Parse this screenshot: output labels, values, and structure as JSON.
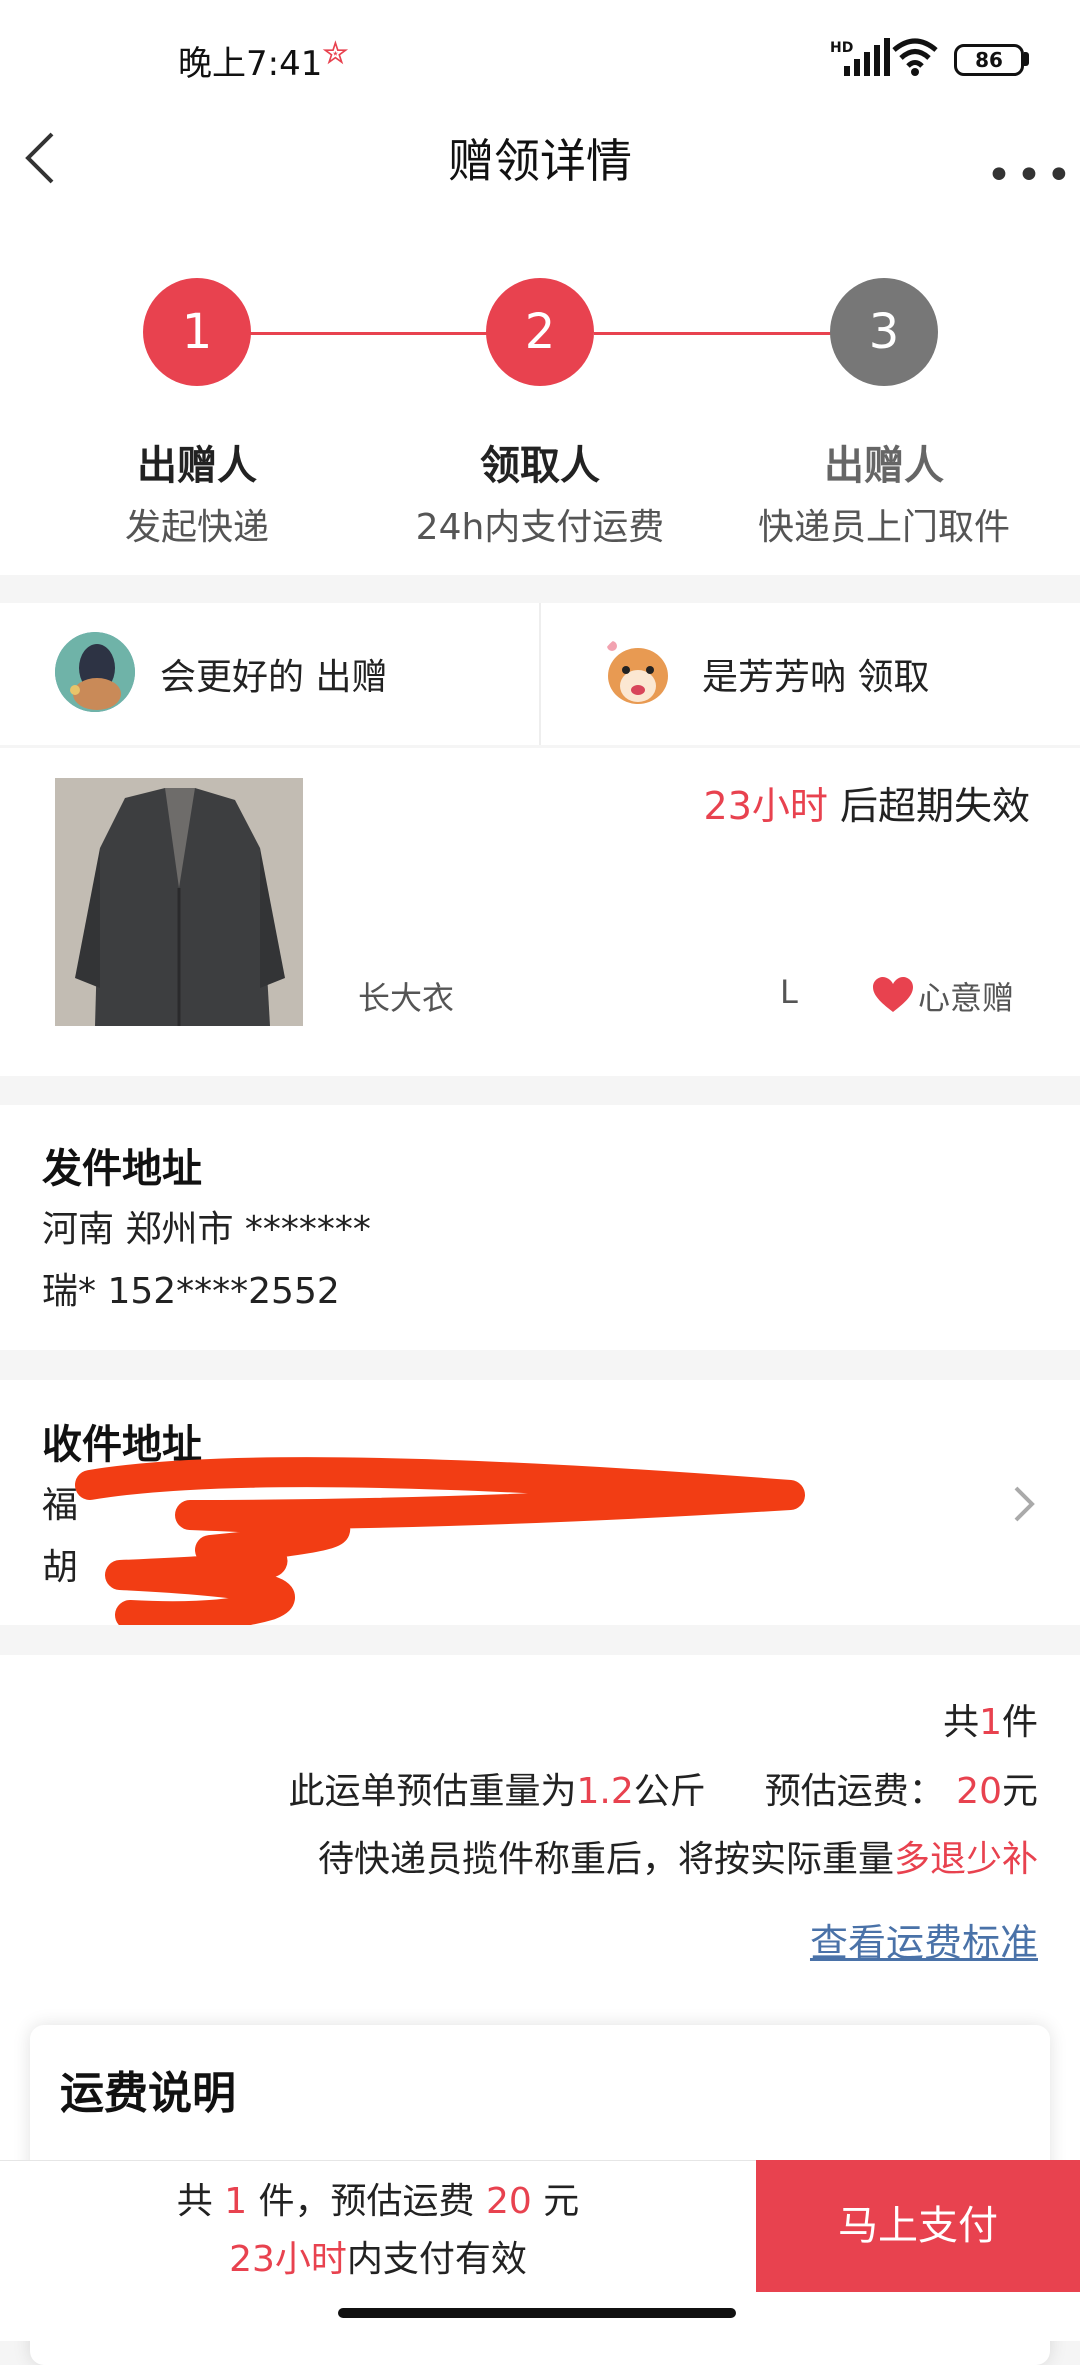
{
  "status_bar": {
    "time": "晚上7:41",
    "network": "HD",
    "battery": "86"
  },
  "header": {
    "title": "赠领详情"
  },
  "steps": [
    {
      "number": "1",
      "title": "出赠人",
      "subtitle": "发起快递"
    },
    {
      "number": "2",
      "title": "领取人",
      "subtitle": "24h内支付运费"
    },
    {
      "number": "3",
      "title": "出赠人",
      "subtitle": "快递员上门取件"
    }
  ],
  "people": {
    "giver": "会更好的 出赠",
    "receiver": "是芳芳吶 领取"
  },
  "item": {
    "expire_time": "23小时",
    "expire_suffix": " 后超期失效",
    "name": "长大衣",
    "size": "L",
    "gift_type": "心意赠"
  },
  "sender_address": {
    "title": "发件地址",
    "line1": "河南 郑州市 *******",
    "line2": "瑞* 152****2552"
  },
  "receiver_address": {
    "title": "收件地址",
    "line1": "福",
    "line2": "胡"
  },
  "fee": {
    "count_prefix": "共",
    "count": "1",
    "count_suffix": "件",
    "weight_prefix": "此运单预估重量为",
    "weight": "1.2",
    "weight_unit": "公斤",
    "fee_prefix": "预估运费：",
    "fee": "20",
    "fee_unit": "元",
    "note_prefix": "待快递员揽件称重后，将按实际重量",
    "note_highlight": "多退少补",
    "standard_link": "查看运费标准"
  },
  "fee_card": {
    "title": "运费说明"
  },
  "bottom": {
    "l1_a": "共 ",
    "l1_count": "1",
    "l1_b": " 件，预估运费 ",
    "l1_fee": "20",
    "l1_c": " 元",
    "l2_time": "23小时",
    "l2_suffix": "内支付有效",
    "pay_button": "马上支付"
  },
  "colors": {
    "accent": "#e8424f",
    "inactive_step": "#777777",
    "link": "#4a72a8"
  }
}
